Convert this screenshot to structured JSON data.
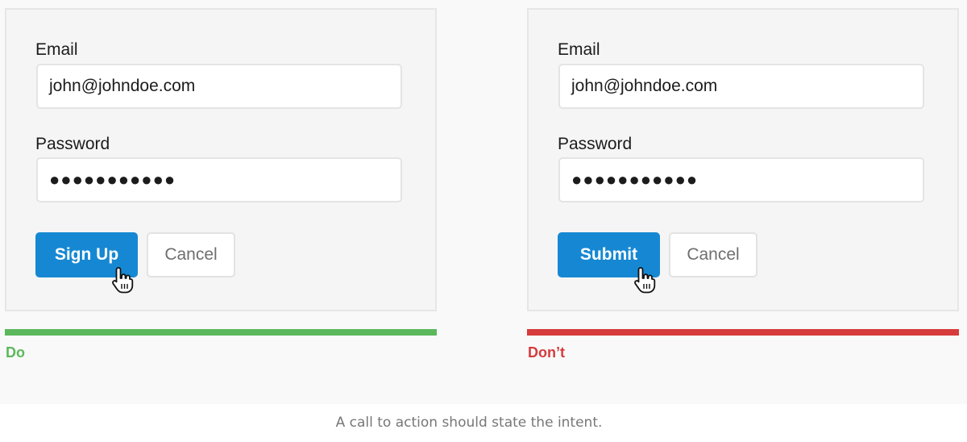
{
  "examples": [
    {
      "email_label": "Email",
      "email_value": "john@johndoe.com",
      "password_label": "Password",
      "password_value": "●●●●●●●●●●●",
      "primary_button": "Sign Up",
      "secondary_button": "Cancel",
      "verdict": "Do",
      "verdict_color": "#5cb85c"
    },
    {
      "email_label": "Email",
      "email_value": "john@johndoe.com",
      "password_label": "Password",
      "password_value": "●●●●●●●●●●●",
      "primary_button": "Submit",
      "secondary_button": "Cancel",
      "verdict": "Don’t",
      "verdict_color": "#d63c3c"
    }
  ],
  "colors": {
    "primary_button": "#1688d3",
    "card_background": "#f5f5f5"
  },
  "icons": {
    "cursor": "hand-pointer-icon"
  },
  "caption": "A call to action should state the intent."
}
